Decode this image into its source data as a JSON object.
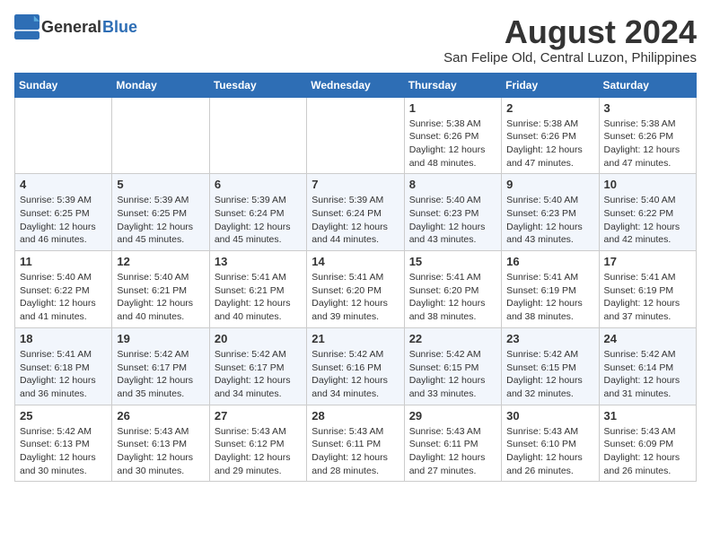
{
  "header": {
    "logo_general": "General",
    "logo_blue": "Blue",
    "title": "August 2024",
    "subtitle": "San Felipe Old, Central Luzon, Philippines"
  },
  "calendar": {
    "days_of_week": [
      "Sunday",
      "Monday",
      "Tuesday",
      "Wednesday",
      "Thursday",
      "Friday",
      "Saturday"
    ],
    "weeks": [
      {
        "cells": [
          {
            "date": "",
            "info": ""
          },
          {
            "date": "",
            "info": ""
          },
          {
            "date": "",
            "info": ""
          },
          {
            "date": "",
            "info": ""
          },
          {
            "date": "1",
            "info": "Sunrise: 5:38 AM\nSunset: 6:26 PM\nDaylight: 12 hours\nand 48 minutes."
          },
          {
            "date": "2",
            "info": "Sunrise: 5:38 AM\nSunset: 6:26 PM\nDaylight: 12 hours\nand 47 minutes."
          },
          {
            "date": "3",
            "info": "Sunrise: 5:38 AM\nSunset: 6:26 PM\nDaylight: 12 hours\nand 47 minutes."
          }
        ]
      },
      {
        "cells": [
          {
            "date": "4",
            "info": "Sunrise: 5:39 AM\nSunset: 6:25 PM\nDaylight: 12 hours\nand 46 minutes."
          },
          {
            "date": "5",
            "info": "Sunrise: 5:39 AM\nSunset: 6:25 PM\nDaylight: 12 hours\nand 45 minutes."
          },
          {
            "date": "6",
            "info": "Sunrise: 5:39 AM\nSunset: 6:24 PM\nDaylight: 12 hours\nand 45 minutes."
          },
          {
            "date": "7",
            "info": "Sunrise: 5:39 AM\nSunset: 6:24 PM\nDaylight: 12 hours\nand 44 minutes."
          },
          {
            "date": "8",
            "info": "Sunrise: 5:40 AM\nSunset: 6:23 PM\nDaylight: 12 hours\nand 43 minutes."
          },
          {
            "date": "9",
            "info": "Sunrise: 5:40 AM\nSunset: 6:23 PM\nDaylight: 12 hours\nand 43 minutes."
          },
          {
            "date": "10",
            "info": "Sunrise: 5:40 AM\nSunset: 6:22 PM\nDaylight: 12 hours\nand 42 minutes."
          }
        ]
      },
      {
        "cells": [
          {
            "date": "11",
            "info": "Sunrise: 5:40 AM\nSunset: 6:22 PM\nDaylight: 12 hours\nand 41 minutes."
          },
          {
            "date": "12",
            "info": "Sunrise: 5:40 AM\nSunset: 6:21 PM\nDaylight: 12 hours\nand 40 minutes."
          },
          {
            "date": "13",
            "info": "Sunrise: 5:41 AM\nSunset: 6:21 PM\nDaylight: 12 hours\nand 40 minutes."
          },
          {
            "date": "14",
            "info": "Sunrise: 5:41 AM\nSunset: 6:20 PM\nDaylight: 12 hours\nand 39 minutes."
          },
          {
            "date": "15",
            "info": "Sunrise: 5:41 AM\nSunset: 6:20 PM\nDaylight: 12 hours\nand 38 minutes."
          },
          {
            "date": "16",
            "info": "Sunrise: 5:41 AM\nSunset: 6:19 PM\nDaylight: 12 hours\nand 38 minutes."
          },
          {
            "date": "17",
            "info": "Sunrise: 5:41 AM\nSunset: 6:19 PM\nDaylight: 12 hours\nand 37 minutes."
          }
        ]
      },
      {
        "cells": [
          {
            "date": "18",
            "info": "Sunrise: 5:41 AM\nSunset: 6:18 PM\nDaylight: 12 hours\nand 36 minutes."
          },
          {
            "date": "19",
            "info": "Sunrise: 5:42 AM\nSunset: 6:17 PM\nDaylight: 12 hours\nand 35 minutes."
          },
          {
            "date": "20",
            "info": "Sunrise: 5:42 AM\nSunset: 6:17 PM\nDaylight: 12 hours\nand 34 minutes."
          },
          {
            "date": "21",
            "info": "Sunrise: 5:42 AM\nSunset: 6:16 PM\nDaylight: 12 hours\nand 34 minutes."
          },
          {
            "date": "22",
            "info": "Sunrise: 5:42 AM\nSunset: 6:15 PM\nDaylight: 12 hours\nand 33 minutes."
          },
          {
            "date": "23",
            "info": "Sunrise: 5:42 AM\nSunset: 6:15 PM\nDaylight: 12 hours\nand 32 minutes."
          },
          {
            "date": "24",
            "info": "Sunrise: 5:42 AM\nSunset: 6:14 PM\nDaylight: 12 hours\nand 31 minutes."
          }
        ]
      },
      {
        "cells": [
          {
            "date": "25",
            "info": "Sunrise: 5:42 AM\nSunset: 6:13 PM\nDaylight: 12 hours\nand 30 minutes."
          },
          {
            "date": "26",
            "info": "Sunrise: 5:43 AM\nSunset: 6:13 PM\nDaylight: 12 hours\nand 30 minutes."
          },
          {
            "date": "27",
            "info": "Sunrise: 5:43 AM\nSunset: 6:12 PM\nDaylight: 12 hours\nand 29 minutes."
          },
          {
            "date": "28",
            "info": "Sunrise: 5:43 AM\nSunset: 6:11 PM\nDaylight: 12 hours\nand 28 minutes."
          },
          {
            "date": "29",
            "info": "Sunrise: 5:43 AM\nSunset: 6:11 PM\nDaylight: 12 hours\nand 27 minutes."
          },
          {
            "date": "30",
            "info": "Sunrise: 5:43 AM\nSunset: 6:10 PM\nDaylight: 12 hours\nand 26 minutes."
          },
          {
            "date": "31",
            "info": "Sunrise: 5:43 AM\nSunset: 6:09 PM\nDaylight: 12 hours\nand 26 minutes."
          }
        ]
      }
    ]
  }
}
